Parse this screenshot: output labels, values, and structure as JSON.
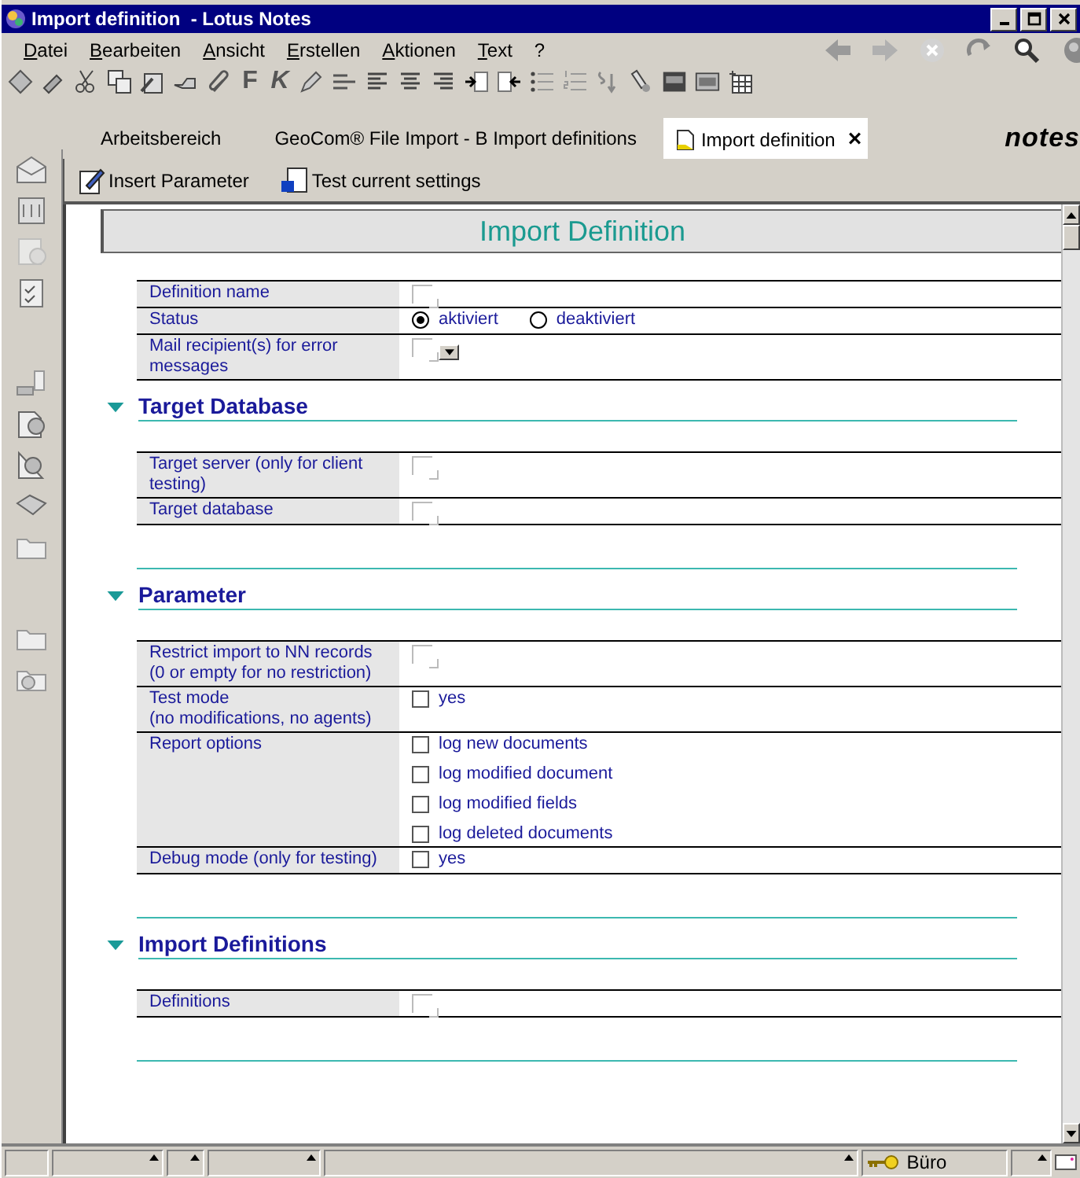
{
  "window": {
    "title": "Import definition  - Lotus Notes"
  },
  "menu": [
    {
      "label": "Datei"
    },
    {
      "label": "Bearbeiten"
    },
    {
      "label": "Ansicht"
    },
    {
      "label": "Erstellen"
    },
    {
      "label": "Aktionen"
    },
    {
      "label": "Text"
    },
    {
      "label": "?"
    }
  ],
  "toolbar": {
    "glyphs": [
      "F",
      "K"
    ]
  },
  "tabs": [
    {
      "label": "Arbeitsbereich",
      "selected": false
    },
    {
      "label": "GeoCom® File Import - B Import definitions",
      "selected": false
    },
    {
      "label": "Import definition",
      "selected": true,
      "close": "×"
    }
  ],
  "brand": "notes",
  "actions": [
    {
      "label": "Insert Parameter"
    },
    {
      "label": "Test current settings"
    }
  ],
  "form": {
    "title": "Import Definition",
    "fields": [
      {
        "kind": "text",
        "label": "Definition name"
      },
      {
        "kind": "radio",
        "label": "Status",
        "options": [
          {
            "label": "aktiviert",
            "selected": true
          },
          {
            "label": "deaktiviert",
            "selected": false
          }
        ]
      },
      {
        "kind": "list",
        "label": "Mail recipient(s) for error\nmessages"
      }
    ],
    "sections": [
      {
        "heading": "Target Database",
        "expanded": true,
        "fields": [
          {
            "kind": "text",
            "label": "Target server (only for client\ntesting)"
          },
          {
            "kind": "text",
            "label": "Target database"
          }
        ]
      },
      {
        "heading": "Parameter",
        "expanded": true,
        "fields": [
          {
            "kind": "text",
            "label": "Restrict import to NN records\n(0 or empty for no restriction)"
          },
          {
            "kind": "checkbox",
            "label": "Test mode\n(no modifications, no agents)",
            "options": [
              {
                "label": "yes",
                "checked": false
              }
            ]
          },
          {
            "kind": "checkbox",
            "label": "Report options",
            "options": [
              {
                "label": "log new documents",
                "checked": false
              },
              {
                "label": "log modified document",
                "checked": false
              },
              {
                "label": "log modified fields",
                "checked": false
              },
              {
                "label": "log deleted documents",
                "checked": false
              }
            ]
          },
          {
            "kind": "checkbox",
            "label": "Debug mode (only for testing)",
            "options": [
              {
                "label": "yes",
                "checked": false
              }
            ]
          }
        ]
      },
      {
        "heading": "Import Definitions",
        "expanded": true,
        "fields": [
          {
            "kind": "text",
            "label": "Definitions"
          }
        ]
      }
    ]
  },
  "status_bar": {
    "location": "Büro"
  }
}
